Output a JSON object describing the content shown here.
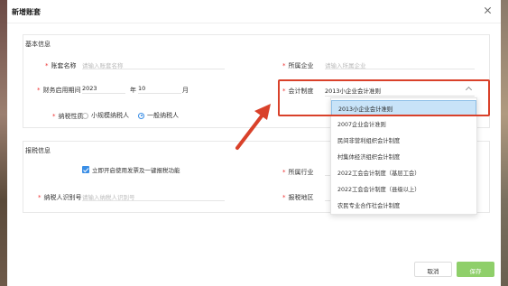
{
  "modal": {
    "title": "新增账套"
  },
  "basic_info": {
    "section_title": "基本信息",
    "account_name": {
      "label": "账套名称",
      "placeholder": "请输入账套名称"
    },
    "company": {
      "label": "所属企业",
      "placeholder": "请输入所属企业"
    },
    "start_period": {
      "label": "财务启用期间",
      "year": "2023",
      "year_unit": "年",
      "month": "10",
      "month_unit": "月"
    },
    "accounting_standard": {
      "label": "会计制度",
      "value": "2013小企业会计准则"
    },
    "taxpayer_type": {
      "label": "纳税性质",
      "options": [
        {
          "label": "小规模纳税人",
          "selected": false
        },
        {
          "label": "一般纳税人",
          "selected": true
        }
      ]
    }
  },
  "tax_info": {
    "section_title": "报税信息",
    "invoice_option": {
      "label": "立即开启使用发票及一键报税功能",
      "checked": true
    },
    "industry": {
      "label": "所属行业"
    },
    "taxpayer_id": {
      "label": "纳税人识别号",
      "placeholder": "请输入纳税人识别号"
    },
    "tax_region": {
      "label": "报税地区"
    }
  },
  "dropdown": {
    "items": [
      "2013小企业会计准则",
      "2007企业会计准则",
      "民间非营利组织会计制度",
      "村集体经济组织会计制度",
      "2022工会会计制度（基层工会）",
      "2022工会会计制度（县级以上）",
      "农民专业合作社会计制度"
    ],
    "selected_index": 0
  },
  "footer": {
    "cancel_label": "取消",
    "save_label": "保存"
  },
  "colors": {
    "accent": "#3a8ee6",
    "highlight": "#d9412a",
    "save_button": "#8fcf6a",
    "active_item": "#c8e3f8"
  }
}
